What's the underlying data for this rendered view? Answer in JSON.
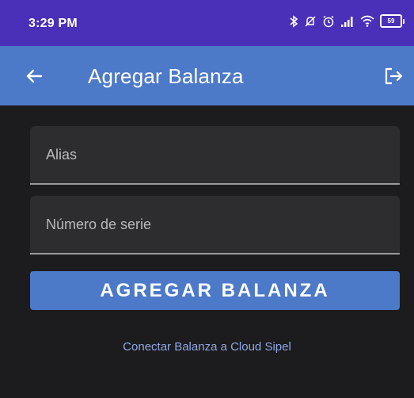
{
  "status_bar": {
    "time": "3:29 PM",
    "battery": "59",
    "icons": [
      "bluetooth-icon",
      "mute-icon",
      "alarm-icon",
      "signal-icon",
      "wifi-icon",
      "battery-icon"
    ]
  },
  "app_bar": {
    "title": "Agregar Balanza",
    "back_icon": "arrow-left-icon",
    "logout_icon": "logout-icon"
  },
  "form": {
    "alias_placeholder": "Alias",
    "alias_value": "",
    "serial_placeholder": "Número de serie",
    "serial_value": "",
    "submit_label": "AGREGAR BALANZA",
    "cloud_link": "Conectar Balanza a Cloud Sipel"
  },
  "colors": {
    "status_bar": "#4a2fb8",
    "app_bar": "#4d79c9",
    "background": "#1c1c1e",
    "field": "#2d2d2f",
    "link": "#8fa7e3"
  }
}
